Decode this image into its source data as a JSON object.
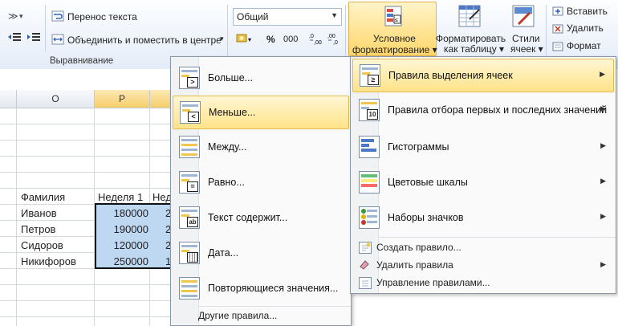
{
  "ribbon": {
    "wrap_text": "Перенос текста",
    "merge_center": "Объединить и поместить в центре",
    "merge_arrow": "▾",
    "alignment_group": "Выравнивание",
    "number_format": "Общий",
    "percent": "%",
    "thousands": "000",
    "cond_format_line1": "Условное",
    "cond_format_line2": "форматирование ▾",
    "format_table_line1": "Форматировать",
    "format_table_line2": "как таблицу ▾",
    "styles_line1": "Стили",
    "styles_line2": "ячеек ▾",
    "insert": "Вставить",
    "delete": "Удалить",
    "format": "Формат"
  },
  "sheet": {
    "col_o": "O",
    "col_p": "P",
    "header_name": "Фамилия",
    "header_week1": "Неделя 1",
    "header_week2_partial": "Нед",
    "rows": [
      {
        "name": "Иванов",
        "week1": "180000",
        "week2_partial": "2"
      },
      {
        "name": "Петров",
        "week1": "190000",
        "week2_partial": "2"
      },
      {
        "name": "Сидоров",
        "week1": "120000",
        "week2_partial": "2"
      },
      {
        "name": "Никифоров",
        "week1": "250000",
        "week2_partial": "1"
      }
    ]
  },
  "main_menu": {
    "items": [
      {
        "label": "Правила выделения ячеек",
        "highlighted": true
      },
      {
        "label": "Правила отбора первых и последних значений"
      },
      {
        "label": "Гистограммы"
      },
      {
        "label": "Цветовые шкалы"
      },
      {
        "label": "Наборы значков"
      }
    ],
    "small_items": [
      {
        "label": "Создать правило..."
      },
      {
        "label": "Удалить правила"
      },
      {
        "label": "Управление правилами..."
      }
    ]
  },
  "sub_menu": {
    "items": [
      {
        "label": "Больше...",
        "symbol": ">"
      },
      {
        "label": "Меньше...",
        "symbol": "<",
        "highlighted": true
      },
      {
        "label": "Между...",
        "symbol": ""
      },
      {
        "label": "Равно...",
        "symbol": "="
      },
      {
        "label": "Текст содержит...",
        "symbol": "ab"
      },
      {
        "label": "Дата...",
        "symbol": ""
      },
      {
        "label": "Повторяющиеся значения...",
        "symbol": ""
      }
    ],
    "other_rules": "Другие правила..."
  },
  "colors": {
    "highlight": "#ffe38a",
    "selection": "#bfd8f2",
    "ribbon": "#e4ecf7"
  }
}
